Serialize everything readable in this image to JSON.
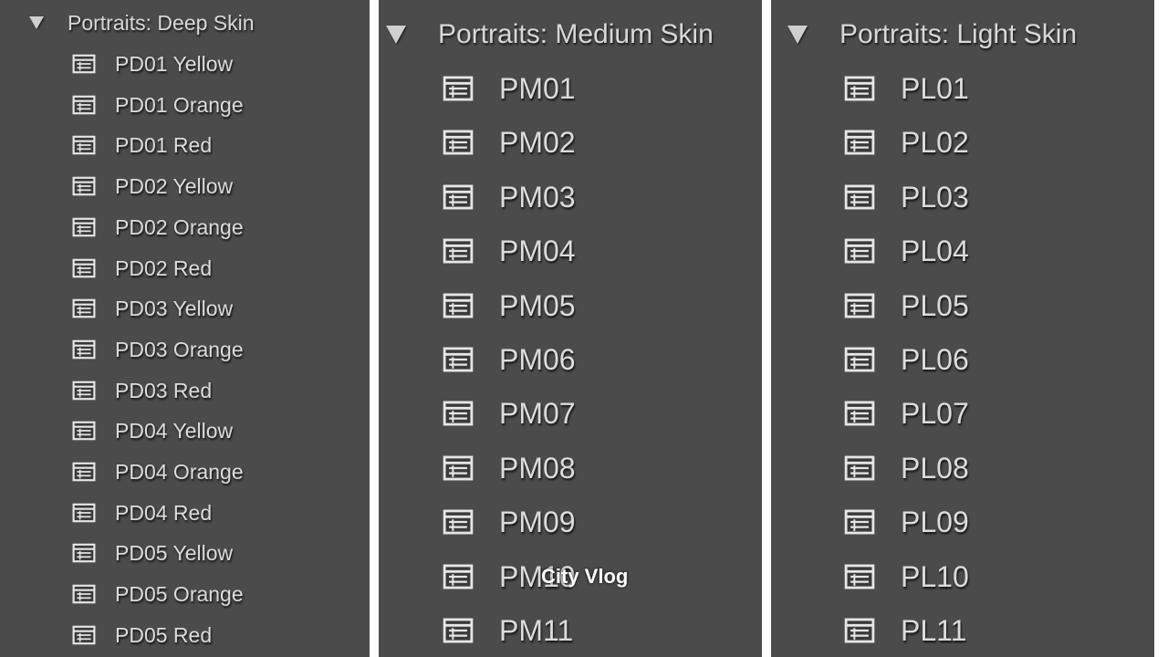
{
  "panels": {
    "deep": {
      "title": "Portraits: Deep Skin",
      "items": [
        "PD01 Yellow",
        "PD01 Orange",
        "PD01 Red",
        "PD02 Yellow",
        "PD02 Orange",
        "PD02 Red",
        "PD03 Yellow",
        "PD03 Orange",
        "PD03 Red",
        "PD04 Yellow",
        "PD04 Orange",
        "PD04 Red",
        "PD05 Yellow",
        "PD05 Orange",
        "PD05 Red"
      ]
    },
    "medium": {
      "title": "Portraits: Medium Skin",
      "items": [
        "PM01",
        "PM02",
        "PM03",
        "PM04",
        "PM05",
        "PM06",
        "PM07",
        "PM08",
        "PM09",
        "PM10",
        "PM11"
      ]
    },
    "light": {
      "title": "Portraits: Light Skin",
      "items": [
        "PL01",
        "PL02",
        "PL03",
        "PL04",
        "PL05",
        "PL06",
        "PL07",
        "PL08",
        "PL09",
        "PL10",
        "PL11"
      ]
    }
  },
  "overlay": {
    "watermark": "City Vlog"
  },
  "colors": {
    "panel_bg": "#4b4b4b",
    "text": "#dcdcdc",
    "separator": "#ffffff"
  },
  "icons": {
    "group_toggle": "disclosure-triangle-icon",
    "preset": "preset-list-icon"
  }
}
